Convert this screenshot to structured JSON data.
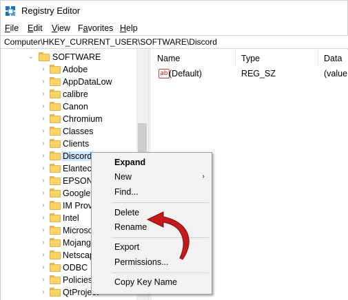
{
  "window": {
    "title": "Registry Editor"
  },
  "menu": [
    {
      "key": "F",
      "rest": "ile"
    },
    {
      "key": "E",
      "rest": "dit"
    },
    {
      "key": "V",
      "rest": "iew"
    },
    {
      "key": "F",
      "rest": "avorites",
      "prefix": "Fa"
    },
    {
      "key": "H",
      "rest": "elp"
    }
  ],
  "menu_labels": {
    "file_u": "F",
    "file_rest": "ile",
    "edit_u": "E",
    "edit_rest": "dit",
    "view_u": "V",
    "view_rest": "iew",
    "fav_pre": "F",
    "fav_u": "a",
    "fav_rest": "vorites",
    "help_u": "H",
    "help_rest": "elp"
  },
  "address": {
    "path": "Computer\\HKEY_CURRENT_USER\\SOFTWARE\\Discord"
  },
  "tree": {
    "parent": "SOFTWARE",
    "items": [
      "Adobe",
      "AppDataLow",
      "calibre",
      "Canon",
      "Chromium",
      "Classes",
      "Clients",
      "Discord",
      "Elantech",
      "EPSON",
      "Google",
      "IM Prov",
      "Intel",
      "Microso",
      "Mojang",
      "Netscap",
      "ODBC",
      "Policies",
      "QtProject"
    ],
    "selected": "Discord"
  },
  "list": {
    "columns": [
      "Name",
      "Type",
      "Data"
    ],
    "rows": [
      {
        "icon": "string-value-icon",
        "icon_text": "ab",
        "name": "(Default)",
        "type": "REG_SZ",
        "data": "(value"
      }
    ]
  },
  "context_menu": {
    "expand": "Expand",
    "new": "New",
    "new_chevron": "›",
    "find": "Find...",
    "delete": "Delete",
    "rename": "Rename",
    "export": "Export",
    "permissions": "Permissions...",
    "copy_key_name": "Copy Key Name"
  },
  "colors": {
    "selection": "#cce8ff",
    "folder": "#ffd56a",
    "arrow": "#c41a1a"
  }
}
